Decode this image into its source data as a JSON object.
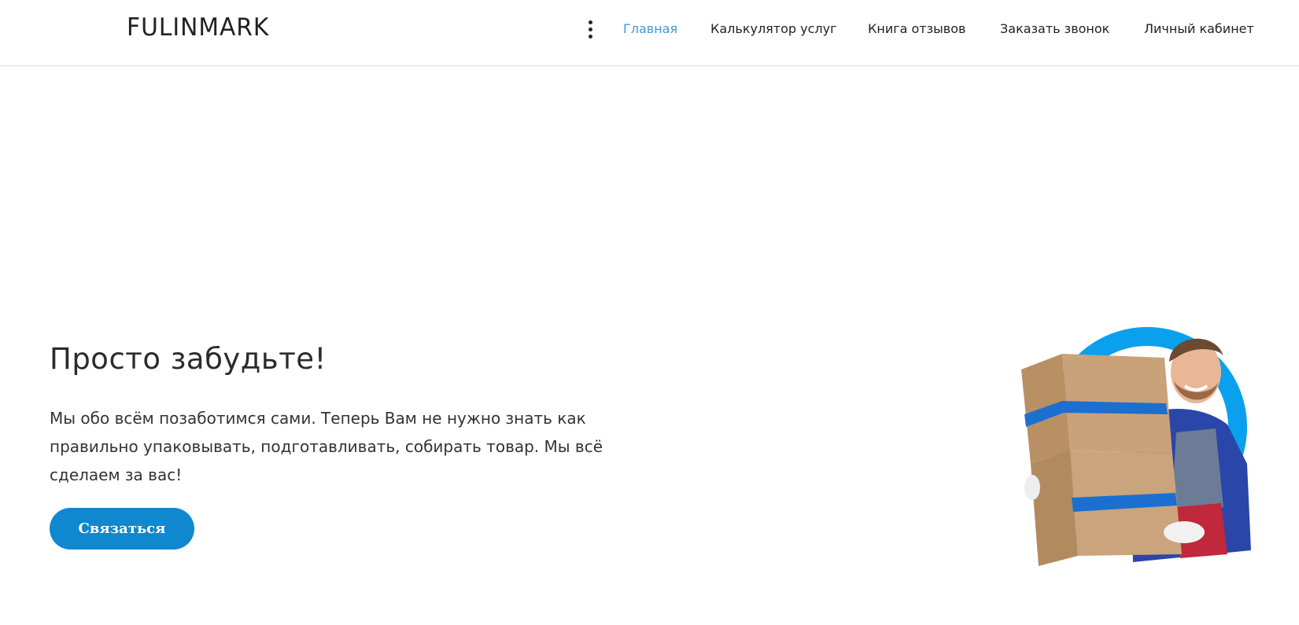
{
  "brand": {
    "logo_text": "FULINMARK"
  },
  "header": {
    "menu_icon": "kebab-vertical-icon",
    "nav": [
      {
        "label": "Главная",
        "active": true
      },
      {
        "label": "Калькулятор услуг",
        "active": false
      },
      {
        "label": "Книга отзывов",
        "active": false
      },
      {
        "label": "Заказать звонок",
        "active": false
      },
      {
        "label": "Личный кабинет",
        "active": false
      }
    ]
  },
  "hero": {
    "title": "Просто забудьте!",
    "text": "Мы обо всём позаботимся сами. Теперь Вам не нужно знать как правильно упаковывать, подготавливать, собирать товар. Мы всё сделаем за вас!",
    "cta_label": "Связаться",
    "image_subject": "delivery-man-with-boxes-illustration"
  },
  "colors": {
    "accent": "#3f9ad8",
    "button": "#0f88cf",
    "ring": "#0aa0ee",
    "text": "#333333"
  }
}
